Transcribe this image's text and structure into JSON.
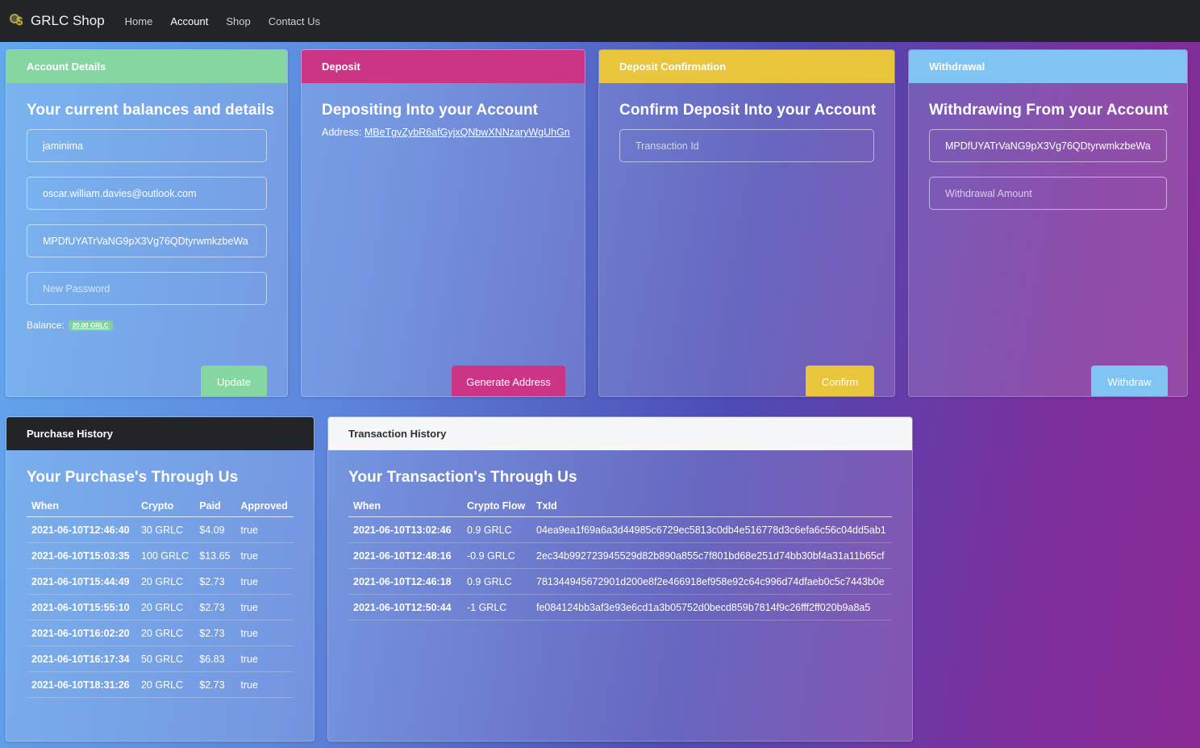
{
  "nav": {
    "brand": "GRLC Shop",
    "links": [
      "Home",
      "Account",
      "Shop",
      "Contact Us"
    ]
  },
  "account": {
    "header": "Account Details",
    "title": "Your current balances and details",
    "username": "jaminima",
    "email": "oscar.william.davies@outlook.com",
    "wallet": "MPDfUYATrVaNG9pX3Vg76QDtyrwmkzbeWa",
    "password_placeholder": "New Password",
    "balance_label": "Balance:",
    "balance_value": "20.00 GRLC",
    "button": "Update"
  },
  "deposit": {
    "header": "Deposit",
    "title": "Depositing Into your Account",
    "address_label": "Address:",
    "address": "MBeTgvZybR6afGyjxQNbwXNNzaryWgUhGn",
    "button": "Generate Address"
  },
  "confirm": {
    "header": "Deposit Confirmation",
    "title": "Confirm Deposit Into your Account",
    "txid_placeholder": "Transaction Id",
    "button": "Confirm"
  },
  "withdrawal": {
    "header": "Withdrawal",
    "title": "Withdrawing From your Account",
    "wallet": "MPDfUYATrVaNG9pX3Vg76QDtyrwmkzbeWa",
    "amount_placeholder": "Withdrawal Amount",
    "button": "Withdraw"
  },
  "purchases": {
    "header": "Purchase History",
    "title": "Your Purchase's Through Us",
    "columns": [
      "When",
      "Crypto",
      "Paid",
      "Approved"
    ],
    "rows": [
      [
        "2021-06-10T12:46:40",
        "30 GRLC",
        "$4.09",
        "true"
      ],
      [
        "2021-06-10T15:03:35",
        "100 GRLC",
        "$13.65",
        "true"
      ],
      [
        "2021-06-10T15:44:49",
        "20 GRLC",
        "$2.73",
        "true"
      ],
      [
        "2021-06-10T15:55:10",
        "20 GRLC",
        "$2.73",
        "true"
      ],
      [
        "2021-06-10T16:02:20",
        "20 GRLC",
        "$2.73",
        "true"
      ],
      [
        "2021-06-10T16:17:34",
        "50 GRLC",
        "$6.83",
        "true"
      ],
      [
        "2021-06-10T18:31:26",
        "20 GRLC",
        "$2.73",
        "true"
      ]
    ]
  },
  "transactions": {
    "header": "Transaction History",
    "title": "Your Transaction's Through Us",
    "columns": [
      "When",
      "Crypto Flow",
      "TxId"
    ],
    "rows": [
      [
        "2021-06-10T13:02:46",
        "0.9 GRLC",
        "04ea9ea1f69a6a3d44985c6729ec5813c0db4e516778d3c6efa6c56c04dd5ab1"
      ],
      [
        "2021-06-10T12:48:16",
        "-0.9 GRLC",
        "2ec34b992723945529d82b890a855c7f801bd68e251d74bb30bf4a31a11b65cf"
      ],
      [
        "2021-06-10T12:46:18",
        "0.9 GRLC",
        "781344945672901d200e8f2e466918ef958e92c64c996d74dfaeb0c5c7443b0e"
      ],
      [
        "2021-06-10T12:50:44",
        "-1 GRLC",
        "fe084124bb3af3e93e6cd1a3b05752d0becd859b7814f9c26fff2ff020b9a8a5"
      ]
    ]
  },
  "colors": {
    "account": "#86d6a2",
    "deposit": "#cc3585",
    "confirm": "#e8c53a",
    "withdrawal": "#80c4f3",
    "purchases": "#222428",
    "transactions": "#f6f7f8"
  }
}
